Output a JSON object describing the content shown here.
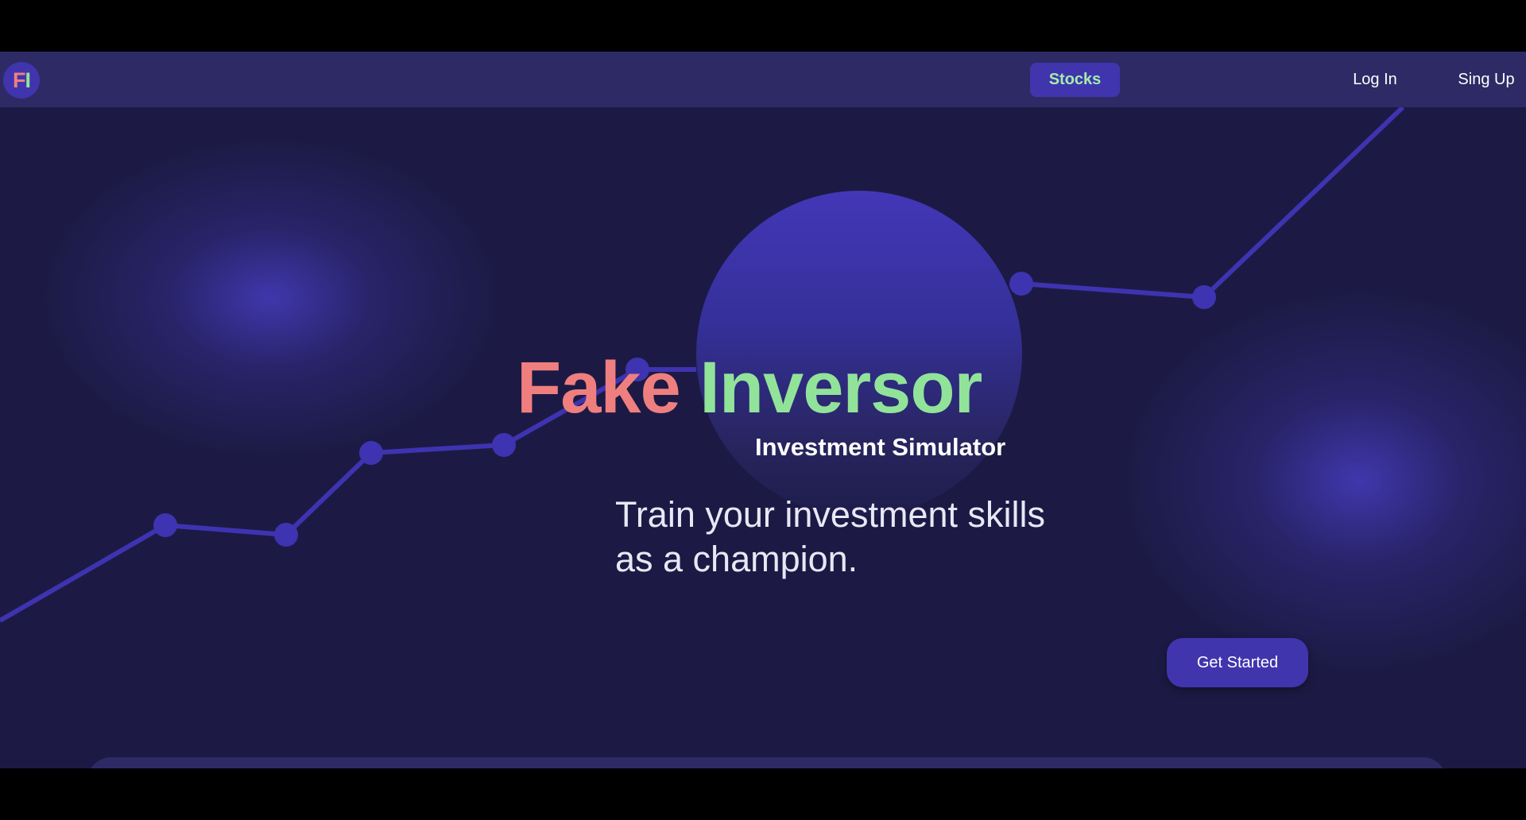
{
  "navbar": {
    "logo_f": "F",
    "logo_i": "I",
    "stocks_label": "Stocks",
    "login_label": "Log In",
    "signup_label": "Sing Up"
  },
  "hero": {
    "title_fake": "Fake",
    "title_inversor": "Inversor",
    "subtitle": "Investment Simulator",
    "tagline": "Train your investment skills as a champion.",
    "cta_label": "Get Started"
  },
  "colors": {
    "background": "#1c1a44",
    "navbar": "#2e2a66",
    "accent": "#4035ad",
    "fake_red": "#ef7f7f",
    "inversor_green": "#92e39a"
  }
}
